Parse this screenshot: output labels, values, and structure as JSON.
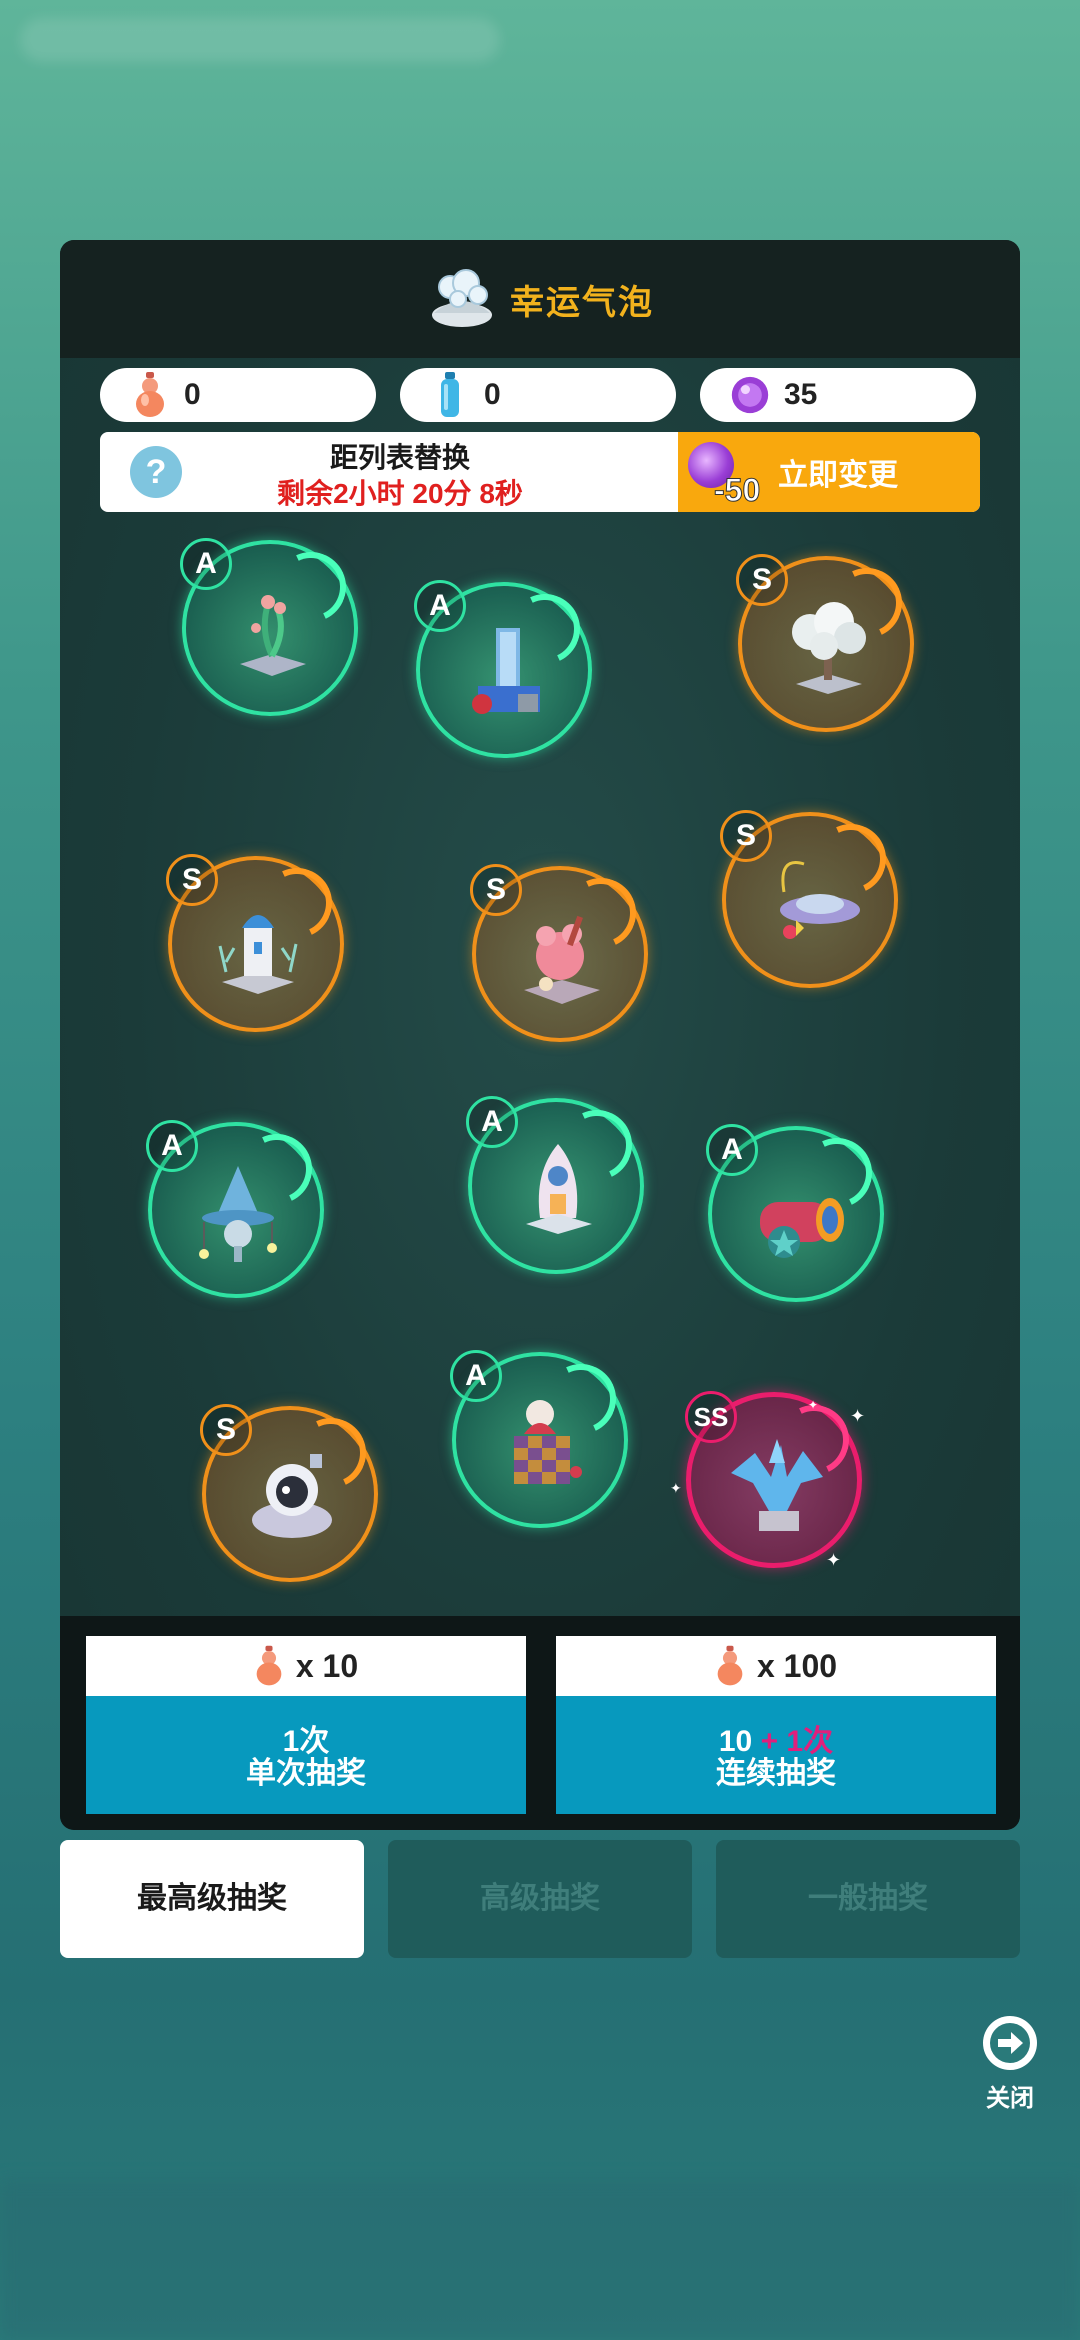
{
  "title": "幸运气泡",
  "currencies": [
    {
      "icon": "gourd-icon",
      "value": "0"
    },
    {
      "icon": "bottle-icon",
      "value": "0"
    },
    {
      "icon": "purple-orb-icon",
      "value": "35"
    }
  ],
  "banner": {
    "title": "距列表替换",
    "timer": "剩余2小时 20分 8秒",
    "change_cost": "-50",
    "change_label": "立即变更"
  },
  "bubbles": [
    {
      "rank": "A",
      "item": "plant-terrarium"
    },
    {
      "rank": "A",
      "item": "tower-shop"
    },
    {
      "rank": "S",
      "item": "white-tree"
    },
    {
      "rank": "S",
      "item": "lighthouse-coral"
    },
    {
      "rank": "S",
      "item": "pink-house"
    },
    {
      "rank": "S",
      "item": "ufo-platform"
    },
    {
      "rank": "A",
      "item": "wizard-hat"
    },
    {
      "rank": "A",
      "item": "rocket"
    },
    {
      "rank": "A",
      "item": "cannon"
    },
    {
      "rank": "S",
      "item": "astronaut-pod"
    },
    {
      "rank": "A",
      "item": "jack-in-the-box"
    },
    {
      "rank": "SS",
      "item": "ice-dragon"
    }
  ],
  "draw": {
    "single": {
      "cost": "x 10",
      "line1": "1次",
      "line2": "单次抽奖"
    },
    "multi": {
      "cost": "x 100",
      "count": "10",
      "bonus": "+ 1次",
      "line2": "连续抽奖"
    }
  },
  "tabs": [
    "最高级抽奖",
    "高级抽奖",
    "一般抽奖"
  ],
  "close_label": "关闭",
  "colors": {
    "accent_orange": "#f9a80d",
    "draw_blue": "#0799be",
    "rank_A": "#2fe2a2",
    "rank_S": "#f0901a",
    "rank_SS": "#ea1d6c",
    "title_gold": "#f2b21d"
  }
}
